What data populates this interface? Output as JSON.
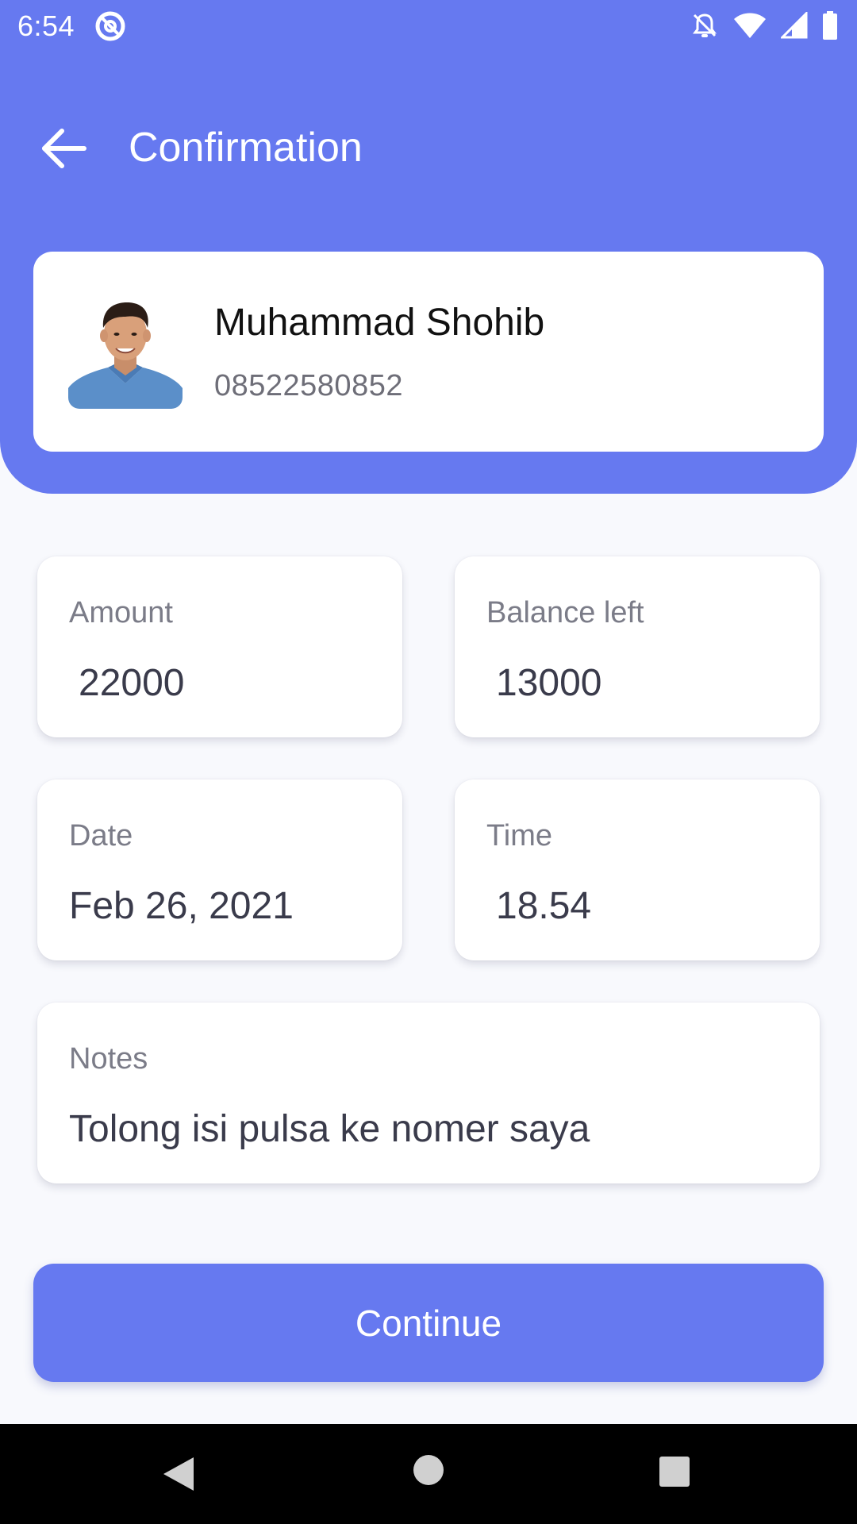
{
  "status_bar": {
    "time": "6:54"
  },
  "app_bar": {
    "title": "Confirmation"
  },
  "contact": {
    "name": "Muhammad Shohib",
    "phone": "08522580852"
  },
  "details": {
    "amount": {
      "label": "Amount",
      "value": "22000"
    },
    "balance_left": {
      "label": "Balance left",
      "value": "13000"
    },
    "date": {
      "label": "Date",
      "value": "Feb 26, 2021"
    },
    "time": {
      "label": "Time",
      "value": "18.54"
    },
    "notes": {
      "label": "Notes",
      "value": "Tolong isi pulsa ke nomer saya"
    }
  },
  "actions": {
    "continue_label": "Continue"
  },
  "colors": {
    "primary": "#6679f0",
    "background": "#f8f9fd",
    "card": "#ffffff"
  },
  "icons": {
    "back": "arrow-left-icon",
    "avatar": "person-photo",
    "status": [
      "do-not-disturb-icon",
      "notifications-off-icon",
      "wifi-icon",
      "signal-icon",
      "battery-icon"
    ],
    "nav": [
      "nav-back-icon",
      "nav-home-icon",
      "nav-recents-icon"
    ]
  }
}
